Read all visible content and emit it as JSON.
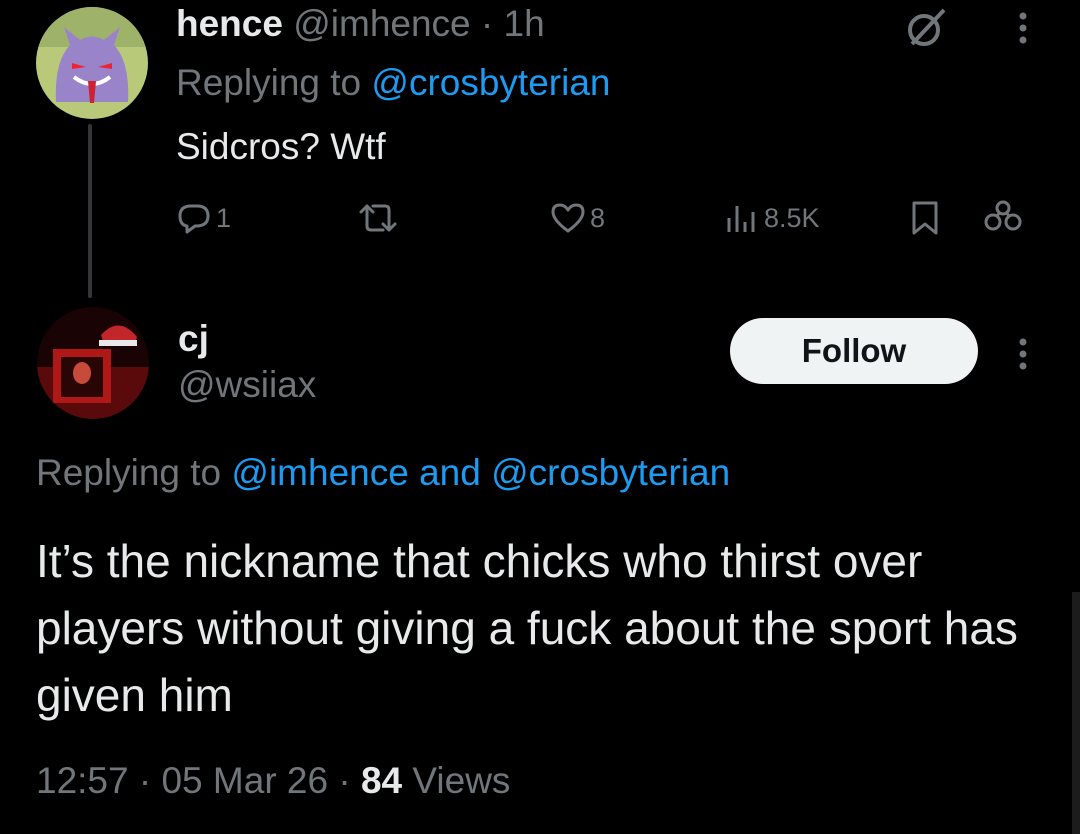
{
  "tweet1": {
    "display_name": "hence",
    "handle": "@imhence",
    "separator": "·",
    "time": "1h",
    "replying_prefix": "Replying to",
    "replying_to": "@crosbyterian",
    "text": "Sidcros? Wtf",
    "reply_count": "1",
    "like_count": "8",
    "view_count": "8.5K",
    "icons": [
      "grok-icon",
      "more-icon",
      "reply-icon",
      "retweet-icon",
      "like-icon",
      "views-icon",
      "bookmark-icon",
      "share-icon"
    ]
  },
  "tweet2": {
    "display_name": "cj",
    "handle": "@wsiiax",
    "follow_label": "Follow",
    "replying_prefix": "Replying to",
    "replying_to_1": "@imhence",
    "replying_and": "and",
    "replying_to_2": "@crosbyterian",
    "text": "It’s the nickname that chicks who thirst over players without giving a fuck about the sport has given him",
    "time": "12:57",
    "sep": "·",
    "date": "05 Mar 26",
    "views_count": "84",
    "views_label": "Views"
  },
  "colors": {
    "background": "#000000",
    "text_primary": "#e7e9ea",
    "text_secondary": "#71767b",
    "link": "#1d9bf0",
    "follow_bg": "#eff3f4"
  }
}
